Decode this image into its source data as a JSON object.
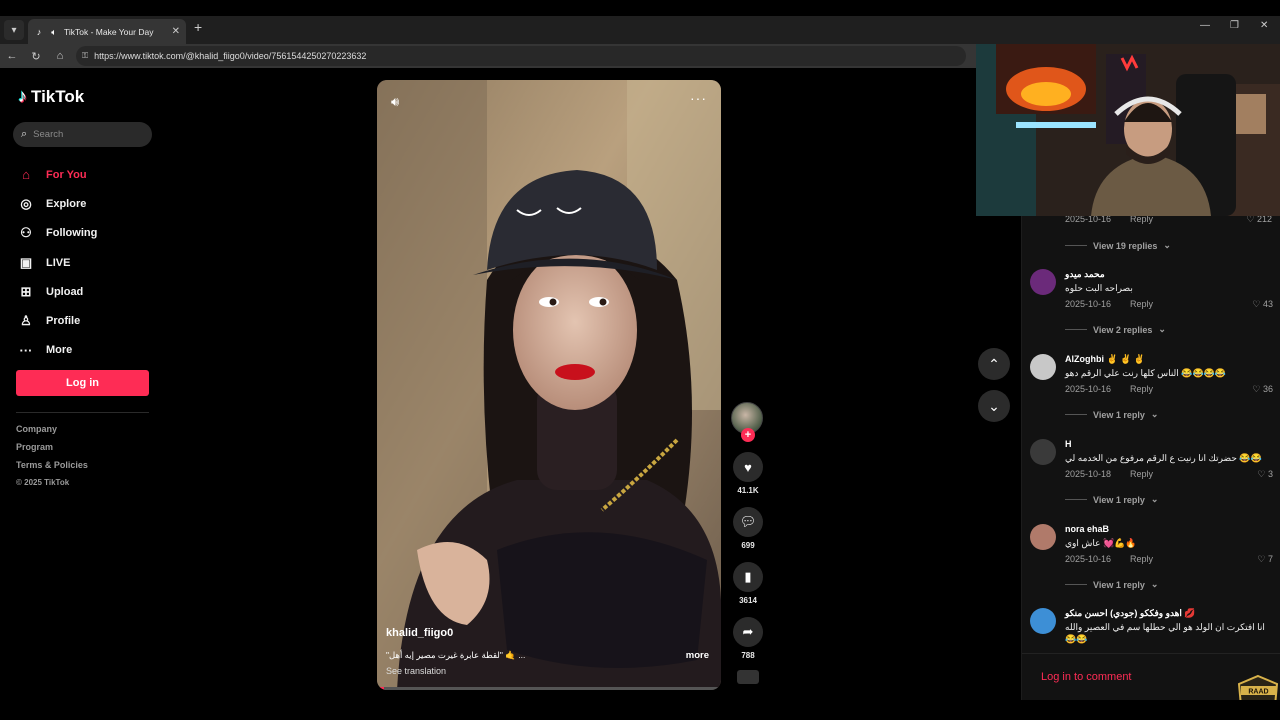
{
  "browser": {
    "tab_title": "TikTok - Make Your Day",
    "url": "https://www.tiktok.com/@khalid_fiigo0/video/7561544250270223632",
    "new_tab": "+",
    "win_min": "—",
    "win_max": "❐",
    "win_close": "✕",
    "tab_close": "✕"
  },
  "sidebar": {
    "logo": "TikTok",
    "search_placeholder": "Search",
    "nav": [
      {
        "label": "For You",
        "icon": "home-icon"
      },
      {
        "label": "Explore",
        "icon": "compass-icon"
      },
      {
        "label": "Following",
        "icon": "following-icon"
      },
      {
        "label": "LIVE",
        "icon": "live-icon"
      },
      {
        "label": "Upload",
        "icon": "upload-icon"
      },
      {
        "label": "Profile",
        "icon": "profile-icon"
      },
      {
        "label": "More",
        "icon": "more-icon"
      }
    ],
    "login": "Log in",
    "footer": [
      "Company",
      "Program",
      "Terms & Policies",
      "© 2025 TikTok"
    ]
  },
  "video": {
    "author": "khalid_fiigo0",
    "description": "\"لقطة عابرة غيرت مصير إيه أهل\" 🤙 ...",
    "translation": "See translation",
    "more": "more",
    "progress": 0.02
  },
  "actions": {
    "likes": "41.1K",
    "comments": "699",
    "saves": "3614",
    "shares": "788"
  },
  "comments": {
    "top_meta": {
      "date": "2025-10-16",
      "reply": "Reply",
      "likes": "212",
      "view": "View 19 replies"
    },
    "items": [
      {
        "name": "محمد ميدو",
        "text": "بصراحه البت حلوه",
        "date": "2025-10-16",
        "reply": "Reply",
        "likes": "43",
        "view": "View 2 replies",
        "avatar_color": "#6b2a7a"
      },
      {
        "name": "AlZoghbi ✌️ ✌️ ✌️",
        "text": "الناس كلها رنت علي الرقم دهو 😂😂😂😂",
        "date": "2025-10-16",
        "reply": "Reply",
        "likes": "36",
        "view": "View 1 reply",
        "avatar_color": "#c8c8c8"
      },
      {
        "name": "H",
        "text": "حضرتك انا رنيت ع الرقم مرفوع من الخدمه لي 😂😂",
        "date": "2025-10-18",
        "reply": "Reply",
        "likes": "3",
        "view": "View 1 reply",
        "avatar_color": "#3a3a3a"
      },
      {
        "name": "nora ehaB",
        "text": "عاش اوي 💓💪🔥",
        "date": "2025-10-16",
        "reply": "Reply",
        "likes": "7",
        "view": "View 1 reply",
        "avatar_color": "#b07a6a"
      },
      {
        "name": "اهدو وفككو (جودي) احسن منكو 💋",
        "text": "انا افتكرت ان الولد هو الي حطلها سم في العصير والله 😂😂",
        "date": "",
        "reply": "",
        "likes": "",
        "view": "",
        "avatar_color": "#3d8fd6"
      }
    ],
    "login_to_comment": "Log in to comment"
  },
  "colors": {
    "accent": "#fe2c55",
    "bg": "#000000",
    "panel": "#121212"
  }
}
